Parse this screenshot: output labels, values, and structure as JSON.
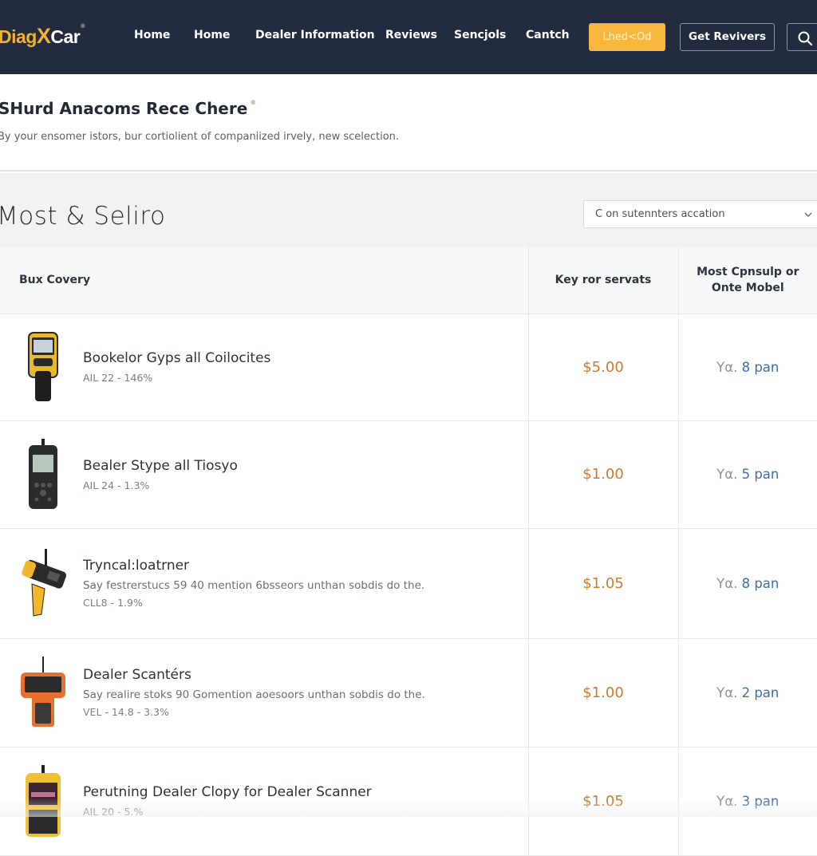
{
  "nav": {
    "logo": {
      "part1": "Diag",
      "part2": "X",
      "part3": "Car",
      "mark": "®"
    },
    "items": [
      {
        "label": "Home"
      },
      {
        "label": "Home"
      },
      {
        "label": "Dealer Information"
      },
      {
        "label": "Reviews"
      },
      {
        "label": "Sencjols"
      },
      {
        "label": "Cantch"
      }
    ],
    "primary_button": "Lhed<Od",
    "outline_button": "Get Revivers",
    "search_icon": "search-icon"
  },
  "hero": {
    "title": "SHurd Anacoms Rece Chere",
    "title_mark": "®",
    "subtitle": "By your ensomer istors, bur cortiolient of companiized irvely, new scelection."
  },
  "section": {
    "title": "Most & Seliro",
    "dropdown": {
      "selected": "C on sutennters accation",
      "icon": "chevron-down-icon"
    }
  },
  "table": {
    "headers": [
      "Bux Covery",
      "Key ror servats",
      "Most Cpnsulp or Onte Mobel"
    ],
    "rows": [
      {
        "name": "Bookelor Gyps all Coilocites",
        "desc": "",
        "meta": "AIL 22 - 146%",
        "price": "$5.00",
        "avail_prefix": "Yα.",
        "avail_value": "8 pan",
        "device": "yellow-handheld"
      },
      {
        "name": "Bealer Stype all Tiosyo",
        "desc": "",
        "meta": "AIL 24 - 1.3%",
        "price": "$1.00",
        "avail_prefix": "Yα.",
        "avail_value": "5 pan",
        "device": "black-handheld"
      },
      {
        "name": "Tryncal:loatrner",
        "desc": "Say festrerstucs 59 40 mention 6bsseors unthan sobdis do the.",
        "meta": "CLL8 - 1.9%",
        "price": "$1.05",
        "avail_prefix": "Yα.",
        "avail_value": "8 pan",
        "device": "pistol-scanner"
      },
      {
        "name": "Dealer Scantérs",
        "desc": "Say realire stoks 90 Gomention aoesoors unthan sobdis do the.",
        "meta": "VEL - 14.8 - 3.3%",
        "price": "$1.00",
        "avail_prefix": "Yα.",
        "avail_value": "2 pan",
        "device": "orange-scanner"
      },
      {
        "name": "Perutning Dealer Clopy for Dealer Scanner",
        "desc": "",
        "meta": "AIL 20 - 5.%",
        "price": "$1.05",
        "avail_prefix": "Yα.",
        "avail_value": "3 pan",
        "device": "yellow-scanner"
      }
    ]
  },
  "colors": {
    "nav_bg": "#222c3e",
    "accent": "#f6b73c",
    "price": "#d07a2c",
    "availability": "#3d6fa8"
  }
}
